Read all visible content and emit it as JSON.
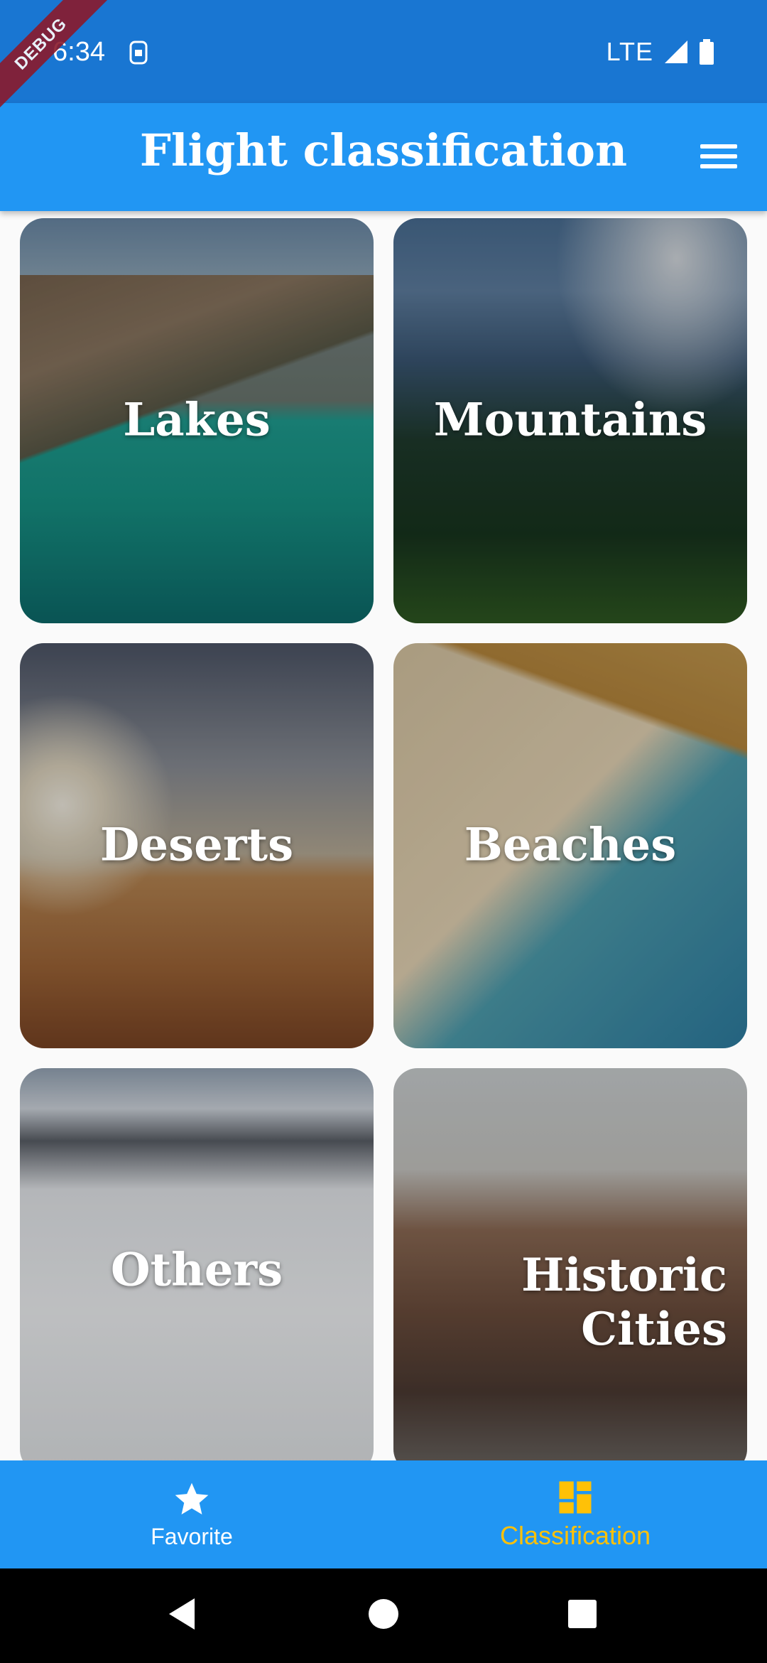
{
  "status_bar": {
    "time": "6:34",
    "network": "LTE",
    "debug_label": "DEBUG"
  },
  "app_bar": {
    "title": "Flight classification",
    "menu_icon": "menu-icon"
  },
  "categories": [
    {
      "label": "Lakes"
    },
    {
      "label": "Mountains"
    },
    {
      "label": "Deserts"
    },
    {
      "label": "Beaches"
    },
    {
      "label": "Others"
    },
    {
      "label": "Historic\nCities"
    }
  ],
  "bottom_nav": {
    "items": [
      {
        "label": "Favorite",
        "icon": "star-icon"
      },
      {
        "label": "Classification",
        "icon": "dashboard-icon",
        "selected": true
      }
    ],
    "selected_color": "#ffc107"
  },
  "colors": {
    "primary": "#2196f3",
    "status_bar": "#1976d2"
  }
}
